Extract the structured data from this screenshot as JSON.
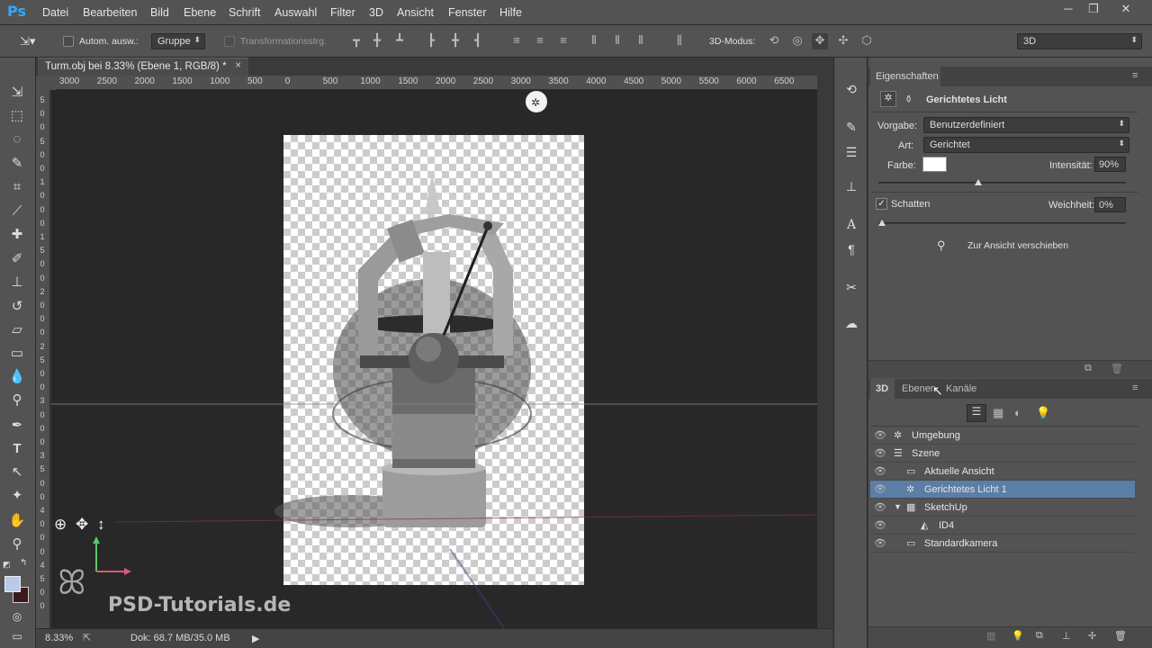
{
  "app": {
    "logo": "Ps"
  },
  "menu": [
    "Datei",
    "Bearbeiten",
    "Bild",
    "Ebene",
    "Schrift",
    "Auswahl",
    "Filter",
    "3D",
    "Ansicht",
    "Fenster",
    "Hilfe"
  ],
  "window": {
    "minimize": "─",
    "restore": "❐",
    "close": "✕"
  },
  "options": {
    "auto_select_label": "Autom. ausw.:",
    "auto_select_value": "Gruppe",
    "transform_label": "Transformationsstrg.",
    "mode_3d_label": "3D-Modus:",
    "workspace": "3D"
  },
  "tab": {
    "title": "Turm.obj bei 8.33% (Ebene 1, RGB/8) *",
    "close": "×"
  },
  "ruler": {
    "h": [
      "3000",
      "2500",
      "2000",
      "1500",
      "1000",
      "500",
      "0",
      "500",
      "1000",
      "1500",
      "2000",
      "2500",
      "3000",
      "3500",
      "4000",
      "4500",
      "5000",
      "5500",
      "6000",
      "6500"
    ],
    "v": [
      "5",
      "0",
      "0",
      "5",
      "0",
      "0",
      "1",
      "0",
      "0",
      "0",
      "1",
      "5",
      "0",
      "0",
      "2",
      "0",
      "0",
      "0",
      "2",
      "5",
      "0",
      "0",
      "3",
      "0",
      "0",
      "0",
      "3",
      "5",
      "0",
      "0",
      "4",
      "0",
      "0",
      "0",
      "4",
      "5",
      "0",
      "0"
    ]
  },
  "watermark": {
    "text": "PSD-Tutorials.de"
  },
  "status": {
    "zoom": "8.33%",
    "doc": "Dok: 68.7 MB/35.0 MB"
  },
  "properties": {
    "tab": "Eigenschaften",
    "title": "Gerichtetes Licht",
    "preset_label": "Vorgabe:",
    "preset_value": "Benutzerdefiniert",
    "type_label": "Art:",
    "type_value": "Gerichtet",
    "color_label": "Farbe:",
    "intensity_label": "Intensität:",
    "intensity_value": "90%",
    "shadow_label": "Schatten",
    "softness_label": "Weichheit:",
    "softness_value": "0%",
    "move_to_view": "Zur Ansicht verschieben",
    "intensity_level": 0.9,
    "softness_level": 0
  },
  "layers_panel": {
    "tabs": [
      "3D",
      "Ebenen",
      "Kanäle"
    ],
    "rows": [
      {
        "label": "Umgebung",
        "indent": 0
      },
      {
        "label": "Szene",
        "indent": 0
      },
      {
        "label": "Aktuelle Ansicht",
        "indent": 1
      },
      {
        "label": "Gerichtetes Licht 1",
        "indent": 1,
        "selected": true
      },
      {
        "label": "SketchUp",
        "indent": 1,
        "expanded": true
      },
      {
        "label": "ID4",
        "indent": 2
      },
      {
        "label": "Standardkamera",
        "indent": 1
      }
    ]
  },
  "colors": {
    "selection": "#5b7ea6",
    "ps_blue": "#31a8ff",
    "fg_color": "#b9c9e8",
    "bg_color": "#3a1a1a"
  }
}
